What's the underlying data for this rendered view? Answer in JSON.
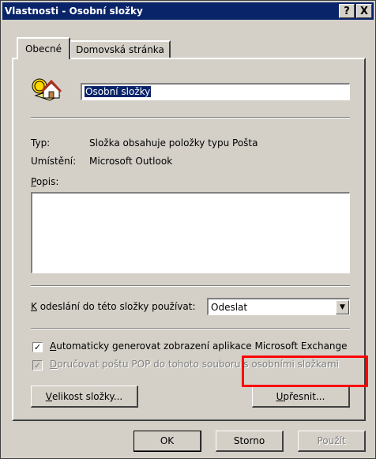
{
  "window": {
    "title": "Vlastnosti - Osobní složky",
    "help_button": "?",
    "close_button": "X"
  },
  "tabs": [
    {
      "label": "Obecné",
      "active": true
    },
    {
      "label": "Domovská stránka",
      "active": false
    }
  ],
  "general": {
    "folder_icon": "folder-house-icon",
    "name_value": "Osobní složky",
    "type_label": "Typ:",
    "type_value": "Složka obsahuje položky typu Pošta",
    "location_label": "Umístění:",
    "location_value": "Microsoft Outlook",
    "description_label_mnemonic": "P",
    "description_label_rest": "opis:",
    "description_value": "",
    "send_label_mnemonic": "K",
    "send_label_rest": " odeslání do této složky používat:",
    "send_value": "Odeslat",
    "exchange_checkbox_mnemonic": "A",
    "exchange_checkbox_rest": "utomaticky generovat zobrazení aplikace Microsoft Exchange",
    "exchange_checked": true,
    "pop_checkbox_mnemonic": "D",
    "pop_checkbox_rest": "oručovat poštu POP do tohoto souboru s osobními složkami",
    "pop_checked": true,
    "pop_enabled": false,
    "folder_size_mnemonic": "V",
    "folder_size_rest": "elikost složky...",
    "advanced_mnemonic": "U",
    "advanced_rest": "přesnit..."
  },
  "footer": {
    "ok_label": "OK",
    "cancel_label": "Storno",
    "apply_label": "Použít"
  },
  "colors": {
    "title_bar": "#0a246a",
    "dialog_face": "#d4d0c8",
    "highlight_box": "#ff0000"
  }
}
